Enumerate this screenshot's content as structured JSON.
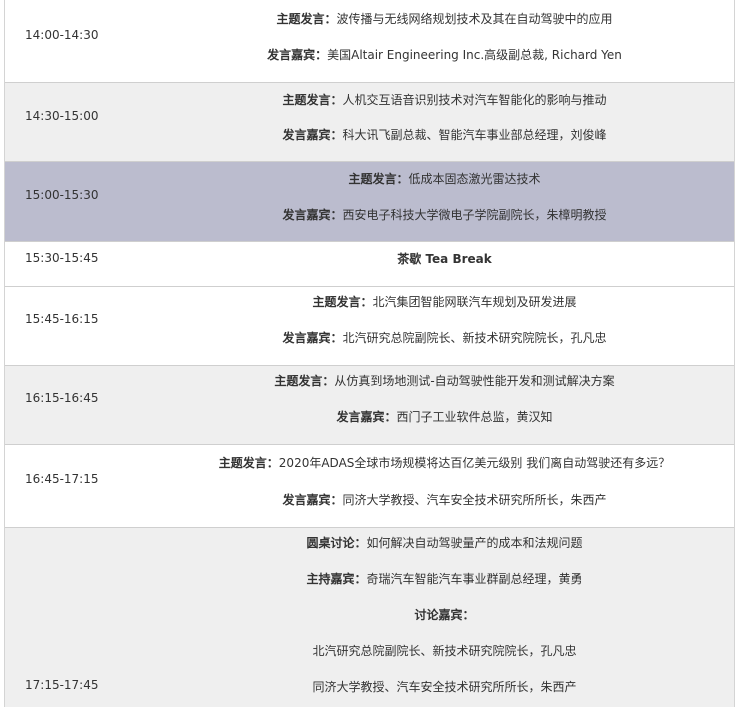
{
  "rows": [
    {
      "time": "14:00-14:30",
      "topic_label": "主题发言：",
      "topic": "波传播与无线网络规划技术及其在自动驾驶中的应用",
      "speaker_label": "发言嘉宾：",
      "speaker": "美国Altair Engineering Inc.高级副总裁, Richard Yen"
    },
    {
      "time": "14:30-15:00",
      "topic_label": "主题发言：",
      "topic": "人机交互语音识别技术对汽车智能化的影响与推动",
      "speaker_label": "发言嘉宾：",
      "speaker": "科大讯飞副总裁、智能汽车事业部总经理，刘俊峰"
    },
    {
      "time": "15:00-15:30",
      "topic_label": "主题发言：",
      "topic": "低成本固态激光雷达技术",
      "speaker_label": "发言嘉宾：",
      "speaker": "西安电子科技大学微电子学院副院长，朱樟明教授"
    },
    {
      "time": "15:30-15:45",
      "title": "茶歇 Tea Break"
    },
    {
      "time": "15:45-16:15",
      "topic_label": "主题发言：",
      "topic": "北汽集团智能网联汽车规划及研发进展",
      "speaker_label": "发言嘉宾：",
      "speaker": "北汽研究总院副院长、新技术研究院院长，孔凡忠"
    },
    {
      "time": "16:15-16:45",
      "topic_label": "主题发言：",
      "topic": "从仿真到场地测试-自动驾驶性能开发和测试解决方案",
      "speaker_label": "发言嘉宾：",
      "speaker": "西门子工业软件总监，黄汉知"
    },
    {
      "time": "16:45-17:15",
      "topic_label": "主题发言：",
      "topic": "2020年ADAS全球市场规模将达百亿美元级别 我们离自动驾驶还有多远？",
      "speaker_label": "发言嘉宾：",
      "speaker": "同济大学教授、汽车安全技术研究所所长，朱西产"
    },
    {
      "time": "17:15-17:45",
      "panel_label": "圆桌讨论：",
      "panel": "如何解决自动驾驶量产的成本和法规问题",
      "host_label": "主持嘉宾：",
      "host": "奇瑞汽车智能汽车事业群副总经理，黄勇",
      "guests_label": "讨论嘉宾：",
      "guest_1": "北汽研究总院副院长、新技术研究院院长，孔凡忠",
      "guest_2": "同济大学教授、汽车安全技术研究所所长，朱西产"
    }
  ]
}
